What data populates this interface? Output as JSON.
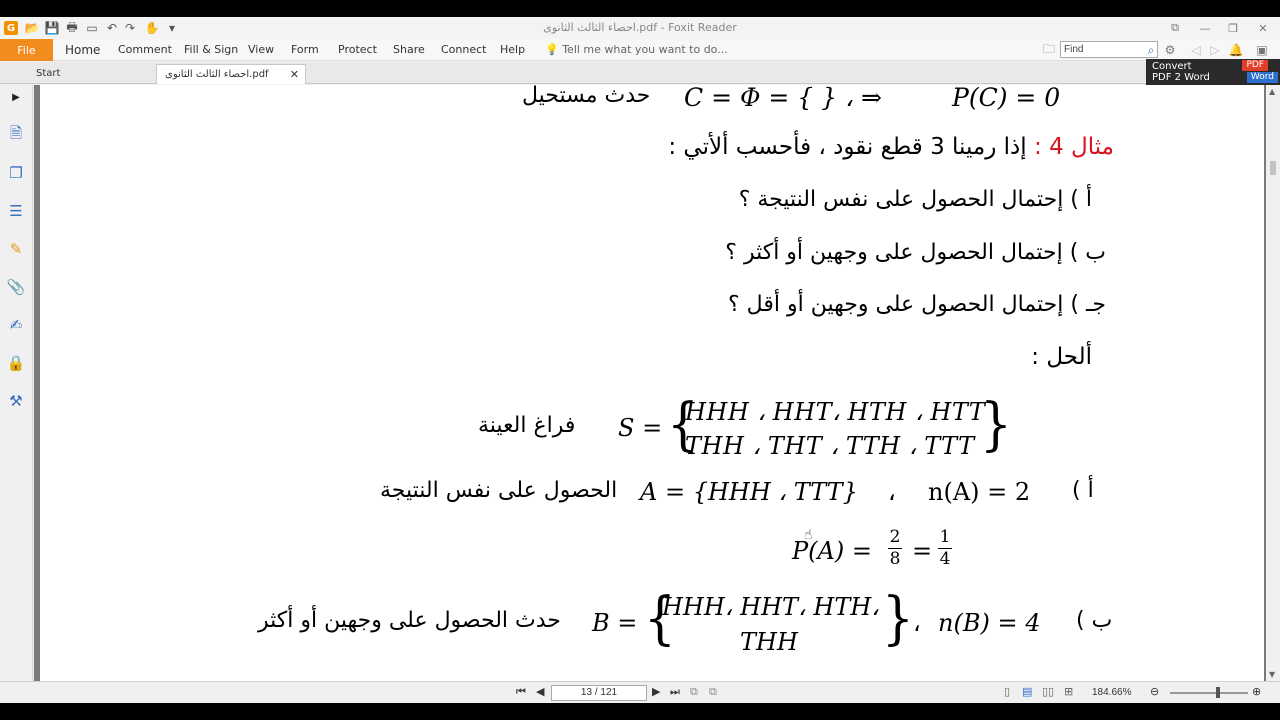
{
  "window": {
    "title": "احصاء الثالث الثانوى.pdf - Foxit Reader",
    "logo": "G"
  },
  "menu": {
    "file": "File",
    "items": [
      "Home",
      "Comment",
      "Fill & Sign",
      "View",
      "Form",
      "Protect",
      "Share",
      "Connect",
      "Help"
    ],
    "tell_me": "Tell me what you want to do...",
    "find_placeholder": "Find"
  },
  "tabs": {
    "start": "Start",
    "file": "احصاء الثالث الثانوى.pdf"
  },
  "convert_banner": {
    "line1": "Convert",
    "line2": "PDF 2 Word",
    "badge_pdf": "PDF",
    "badge_word": "Word"
  },
  "document": {
    "line_top_ar": "حدث مستحيل",
    "line_top_math": "C = Φ = { } ، ⇒",
    "line_top_result": "P(C) = 0",
    "example_label": "مثال 4 :",
    "example_text": "إذا رمينا 3 قطع نقود ، فأحسب ألأتي :",
    "q_a": "أ ) إحتمال الحصول على نفس النتيجة ؟",
    "q_b": "ب ) إحتمال الحصول على وجهين أو أكثر ؟",
    "q_c": "جـ ) إحتمال الحصول على وجهين أو أقل ؟",
    "solution": "ألحل :",
    "sample_space_label": "فراغ العينة",
    "s_eq": "S =",
    "s_row1": "HHH ، HHT، HTH ، HTT",
    "s_row2": "THH ، THT ، TTH ، TTT",
    "a_marker": "أ )",
    "a_n": "n(A) = 2",
    "a_sep": "،",
    "a_set": "A = {HHH ، TTT}",
    "a_label": "الحصول على نفس النتيجة",
    "pa_lhs": "P(A) =",
    "pa_num1": "2",
    "pa_den1": "8",
    "pa_eq": "=",
    "pa_num2": "1",
    "pa_den2": "4",
    "b_marker": "ب )",
    "b_n": "n(B) = 4",
    "b_sep": "،",
    "b_eq": "B =",
    "b_row1": "HHH، HHT، HTH،",
    "b_row2": "THH",
    "b_label": "حدث الحصول على وجهين أو أكثر"
  },
  "status": {
    "page_indicator": "13 / 121",
    "zoom": "184.66%"
  }
}
